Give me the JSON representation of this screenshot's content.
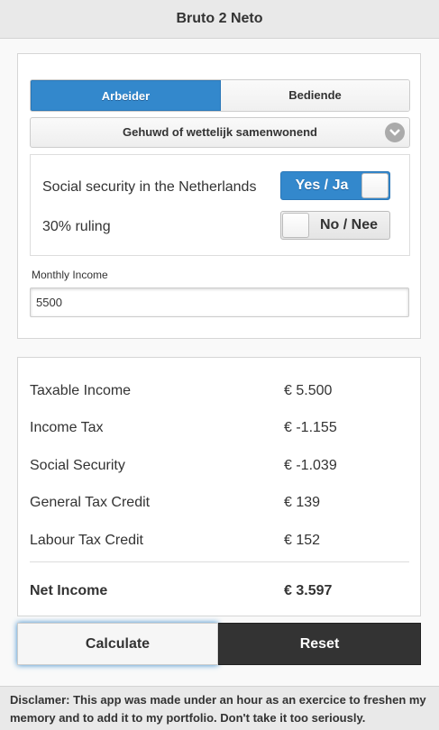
{
  "header": {
    "title": "Bruto 2 Neto"
  },
  "employee_type": {
    "options": [
      "Arbeider",
      "Bediende"
    ],
    "selected": "Arbeider"
  },
  "marital_status": {
    "selected": "Gehuwd of wettelijk samenwonend",
    "icon": "chevron-down-icon"
  },
  "toggles": {
    "social_security": {
      "label": "Social security in the Netherlands",
      "value": "Yes / Ja",
      "on": true
    },
    "ruling_30": {
      "label": "30% ruling",
      "value": "No / Nee",
      "on": false
    }
  },
  "income": {
    "label": "Monthly Income",
    "value": "5500"
  },
  "results": {
    "taxable_income": {
      "label": "Taxable Income",
      "value": "€ 5.500"
    },
    "income_tax": {
      "label": "Income Tax",
      "value": "€ -1.155"
    },
    "social_security": {
      "label": "Social Security",
      "value": "€ -1.039"
    },
    "general_tax_credit": {
      "label": "General Tax Credit",
      "value": "€ 139"
    },
    "labour_tax_credit": {
      "label": "Labour Tax Credit",
      "value": "€ 152"
    },
    "net_income": {
      "label": "Net Income",
      "value": "€ 3.597"
    }
  },
  "buttons": {
    "calculate": "Calculate",
    "reset": "Reset"
  },
  "footer": {
    "disclaimer": "Disclamer: This app was made under an hour as an exercice to freshen my memory and to add it to my portfolio. Don't take it too seriously."
  },
  "colors": {
    "accent": "#3388cc",
    "dark_button": "#333333"
  }
}
